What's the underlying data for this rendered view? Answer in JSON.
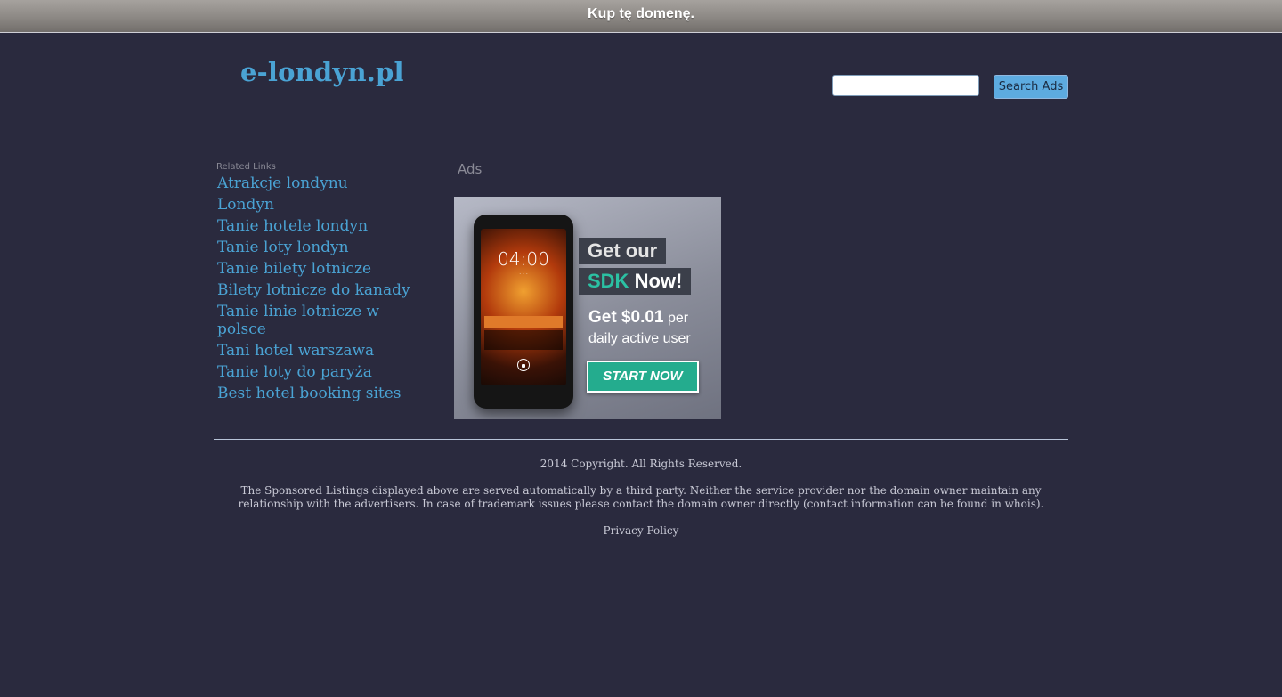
{
  "topbar": {
    "buy_domain_label": "Kup tę domenę."
  },
  "header": {
    "logo_text": "e-londyn.pl",
    "search_value": "",
    "search_button_label": "Search Ads"
  },
  "related": {
    "title": "Related Links",
    "items": [
      "Atrakcje londynu",
      "Londyn",
      "Tanie hotele londyn",
      "Tanie loty londyn",
      "Tanie bilety lotnicze",
      "Bilety lotnicze do kanady",
      "Tanie linie lotnicze w polsce",
      "Tani hotel warszawa",
      "Tanie loty do paryża",
      "Best hotel booking sites"
    ]
  },
  "ads": {
    "title": "Ads",
    "banner": {
      "phone_time": "04:00",
      "line1": "Get our",
      "line2_highlight": "SDK",
      "line2_rest": "Now!",
      "copy_bold": "Get $0.01",
      "copy_rest": "per",
      "copy_line2": "daily active user",
      "cta_label": "START NOW",
      "accent_color": "#2bc1a3"
    }
  },
  "footer": {
    "copyright": "2014 Copyright. All Rights Reserved.",
    "disclaimer": "The Sponsored Listings displayed above are served automatically by a third party. Neither the service provider nor the domain owner maintain any relationship with the advertisers. In case of trademark issues please contact the domain owner directly (contact information can be found in whois).",
    "privacy_label": "Privacy Policy"
  },
  "colors": {
    "background": "#2a2a3e",
    "link": "#4aa3d4",
    "muted": "#8a8a96",
    "footer_text": "#c9cad6"
  }
}
